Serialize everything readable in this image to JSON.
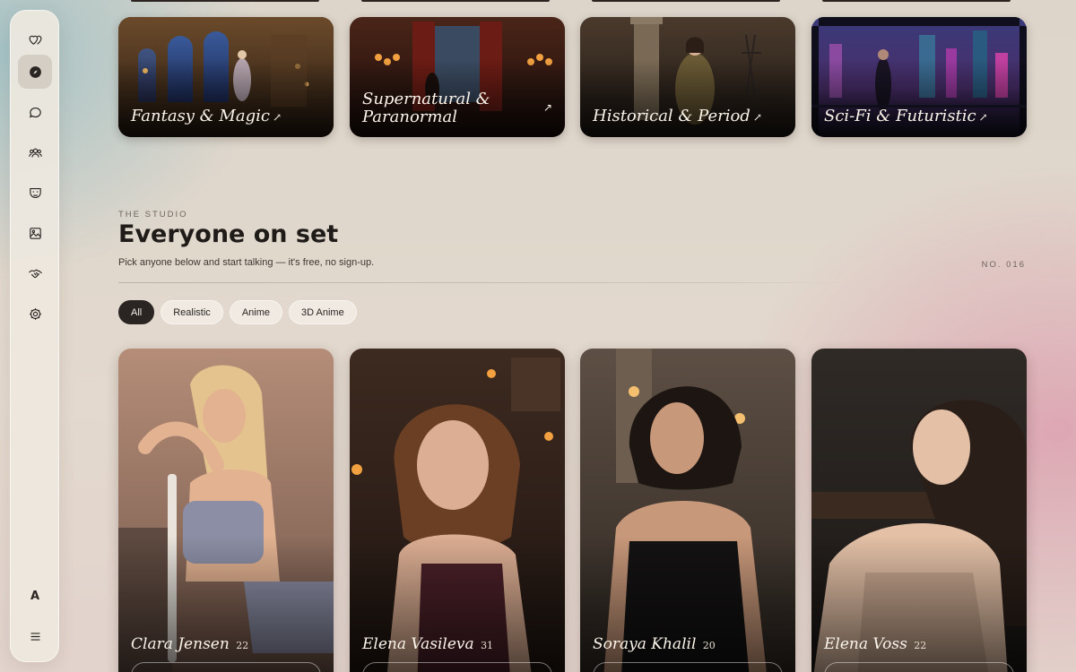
{
  "sidebar": {
    "items": [
      {
        "icon": "logo-hearts-icon"
      },
      {
        "icon": "compass-icon",
        "active": true
      },
      {
        "icon": "chat-bubble-icon"
      },
      {
        "icon": "users-icon"
      },
      {
        "icon": "mask-icon"
      },
      {
        "icon": "image-icon"
      },
      {
        "icon": "handshake-icon"
      },
      {
        "icon": "gear-icon"
      }
    ],
    "bottom_letter": "A",
    "menu_icon": "hamburger-menu-icon"
  },
  "genres": [
    {
      "label": "Fantasy & Magic",
      "arrow": "↗",
      "colors": [
        "#6b4a2a",
        "#2a3f6a",
        "#c89a55"
      ]
    },
    {
      "label": "Supernatural & Paranormal",
      "arrow": "↗",
      "colors": [
        "#3b1e14",
        "#6b1c14",
        "#d58a3a"
      ]
    },
    {
      "label": "Historical & Period",
      "arrow": "↗",
      "colors": [
        "#4a3a2a",
        "#2a2320",
        "#9a7a55"
      ]
    },
    {
      "label": "Sci-Fi & Futuristic",
      "arrow": "↗",
      "colors": [
        "#2a2a5a",
        "#6a3a8a",
        "#3a8aa0"
      ]
    }
  ],
  "studio": {
    "eyebrow": "THE STUDIO",
    "title": "Everyone on set",
    "subtitle": "Pick anyone below and start talking — it's free, no sign-up.",
    "number": "NO. 016"
  },
  "filters": [
    {
      "label": "All",
      "active": true
    },
    {
      "label": "Realistic",
      "active": false
    },
    {
      "label": "Anime",
      "active": false
    },
    {
      "label": "3D Anime",
      "active": false
    }
  ],
  "characters": [
    {
      "name": "Clara Jensen",
      "age": "22",
      "bg": "#b58d78",
      "bg2": "#6f5448",
      "hair": "#e4c38e",
      "skin": "#e2b291",
      "outfit": "#8c8ea5"
    },
    {
      "name": "Elena Vasileva",
      "age": "31",
      "bg": "#3d2a20",
      "bg2": "#1e1410",
      "hair": "#6a3f24",
      "skin": "#dcae93",
      "outfit": "#4a2028"
    },
    {
      "name": "Soraya Khalil",
      "age": "20",
      "bg": "#5d4f44",
      "bg2": "#2c2520",
      "hair": "#1c1512",
      "skin": "#c8987a",
      "outfit": "#141212"
    },
    {
      "name": "Elena Voss",
      "age": "22",
      "bg": "#2f2a26",
      "bg2": "#1a1614",
      "hair": "#2a1e18",
      "skin": "#e3c0a6",
      "outfit": "#c9a890"
    }
  ]
}
